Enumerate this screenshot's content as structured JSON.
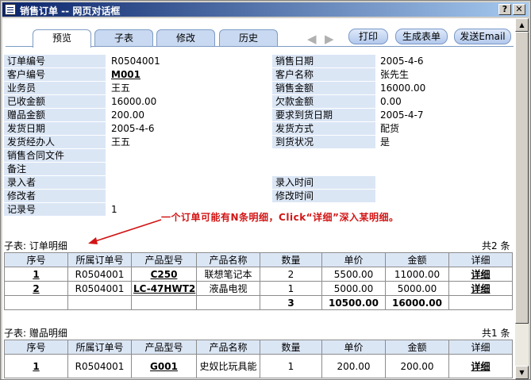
{
  "window": {
    "title": "销售订单 -- 网页对话框",
    "help_label": "?",
    "close_label": "✕"
  },
  "tabs": [
    "预览",
    "子表",
    "修改",
    "历史"
  ],
  "nav": {
    "prev": "◀",
    "next": "▶"
  },
  "actions": {
    "print": "打印",
    "generate": "生成表单",
    "email": "发送Email"
  },
  "fields_left": [
    {
      "label": "订单编号",
      "value": "R0504001"
    },
    {
      "label": "客户编号",
      "value": "M001"
    },
    {
      "label": "业务员",
      "value": "王五"
    },
    {
      "label": "已收金额",
      "value": "16000.00"
    },
    {
      "label": "赠品金额",
      "value": "200.00"
    },
    {
      "label": "发货日期",
      "value": "2005-4-6"
    },
    {
      "label": "发货经办人",
      "value": "王五"
    },
    {
      "label": "销售合同文件",
      "value": ""
    },
    {
      "label": "备注",
      "value": ""
    },
    {
      "label": "录入者",
      "value": ""
    },
    {
      "label": "修改者",
      "value": ""
    },
    {
      "label": "记录号",
      "value": "1"
    }
  ],
  "fields_right": [
    {
      "label": "销售日期",
      "value": "2005-4-6"
    },
    {
      "label": "客户名称",
      "value": "张先生"
    },
    {
      "label": "销售金额",
      "value": "16000.00"
    },
    {
      "label": "欠款金额",
      "value": "0.00"
    },
    {
      "label": "要求到货日期",
      "value": "2005-4-7"
    },
    {
      "label": "发货方式",
      "value": "配货"
    },
    {
      "label": "到货状况",
      "value": "是"
    },
    {
      "label": "录入时间",
      "value": ""
    },
    {
      "label": "修改时间",
      "value": ""
    }
  ],
  "annotation": "一个订单可能有N条明细，Click“详细”深入某明细。",
  "order_details": {
    "title": "子表: 订单明细",
    "count": "共2 条",
    "columns": [
      "序号",
      "所属订单号",
      "产品型号",
      "产品名称",
      "数量",
      "单价",
      "金额",
      "详细"
    ],
    "rows": [
      [
        "1",
        "R0504001",
        "C250",
        "联想笔记本",
        "2",
        "5500.00",
        "11000.00",
        "详细"
      ],
      [
        "2",
        "R0504001",
        "LC-47HWT2",
        "液晶电视",
        "1",
        "5000.00",
        "5000.00",
        "详细"
      ]
    ],
    "total": [
      "",
      "",
      "",
      "",
      "3",
      "10500.00",
      "16000.00",
      ""
    ]
  },
  "gift_details": {
    "title": "子表: 赠品明细",
    "count": "共1 条",
    "columns": [
      "序号",
      "所属订单号",
      "产品型号",
      "产品名称",
      "数量",
      "单价",
      "金额",
      "详细"
    ],
    "rows": [
      [
        "1",
        "R0504001",
        "G001",
        "史奴比玩具能",
        "1",
        "200.00",
        "200.00",
        "详细"
      ]
    ]
  },
  "colors": {
    "label_bg": "#dbe6f5",
    "annotation": "#d21414",
    "titlebar": "#0a246a"
  }
}
